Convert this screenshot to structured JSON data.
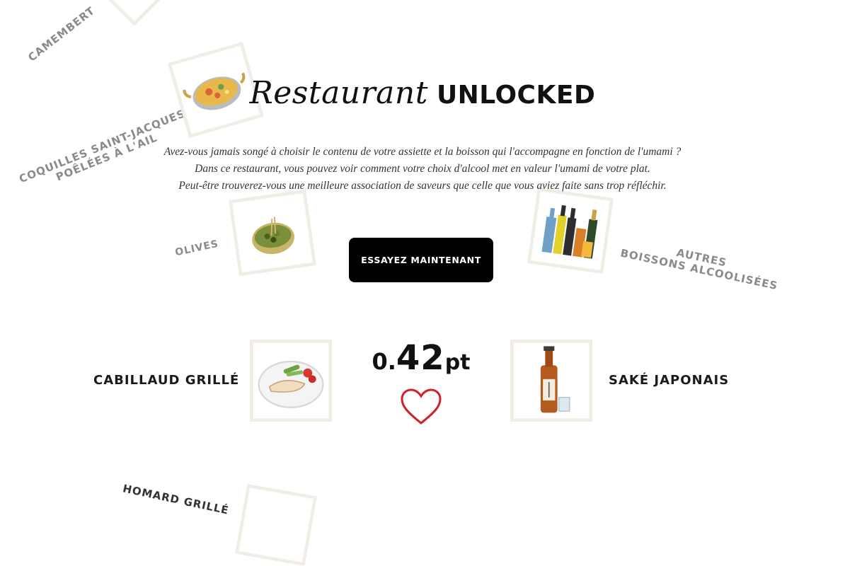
{
  "background_labels": {
    "camembert": "CAMEMBERT",
    "coquilles_line1": "COQUILLES SAINT-JACQUES",
    "coquilles_line2": "POÊLÉES À L'AIL",
    "olives": "OLIVES",
    "autres_line1": "AUTRES",
    "autres_line2": "BOISSONS ALCOOLISÉES",
    "homard": "HOMARD GRILLÉ"
  },
  "header": {
    "title_script": "Restaurant",
    "title_bold": "UNLOCKED"
  },
  "intro": {
    "line1": "Avez-vous jamais songé à choisir le contenu de votre assiette et la boisson qui l'accompagne en fonction de l'umami ?",
    "line2": "Dans ce restaurant, vous pouvez voir comment votre choix d'alcool met en valeur l'umami de votre plat.",
    "line3": "Peut-être trouverez-vous une meilleure association de saveurs que celle que vous aviez faite sans trop réfléchir."
  },
  "cta": {
    "label": "ESSAYEZ MAINTENANT"
  },
  "pairing": {
    "dish": "CABILLAUD GRILLÉ",
    "drink": "SAKÉ JAPONAIS",
    "score_int": "0.",
    "score_dec": "42",
    "score_unit": "pt"
  },
  "colors": {
    "accent_heart": "#d0202a",
    "button_bg": "#000000",
    "tile_border": "#f1ede6"
  },
  "icons": {
    "heart": "heart-icon",
    "paella": "paella-pan-icon",
    "olives_bowl": "olive-bowl-icon",
    "bottles": "liquor-bottles-icon",
    "fish": "grilled-fish-icon",
    "sake": "sake-bottle-icon"
  }
}
